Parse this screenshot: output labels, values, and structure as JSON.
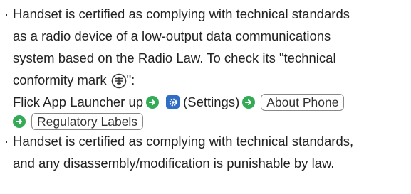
{
  "items": [
    {
      "bullet": "·",
      "lines": [
        "Handset is certified as complying with technical standards",
        "as a radio device of a low-output data communications",
        "system based on the Radio Law. To check its \"technical",
        "conformity mark",
        "\":"
      ],
      "nav": {
        "prefix": "Flick App Launcher up",
        "settings_label": "(Settings)",
        "about_phone": "About Phone",
        "regulatory_labels": "Regulatory Labels"
      },
      "icons": {
        "arrow": "arrow-right-icon",
        "settings": "settings-gear-icon",
        "conformity_mark": "technical-conformity-mark-icon"
      }
    },
    {
      "bullet": "·",
      "lines": [
        "Handset is certified as complying with technical standards,",
        "and any disassembly/modification is punishable by law."
      ]
    }
  ],
  "colors": {
    "arrow": "#33aa55",
    "settings_icon": "#2f6ec4",
    "button_border": "#888888",
    "text": "#222222"
  }
}
